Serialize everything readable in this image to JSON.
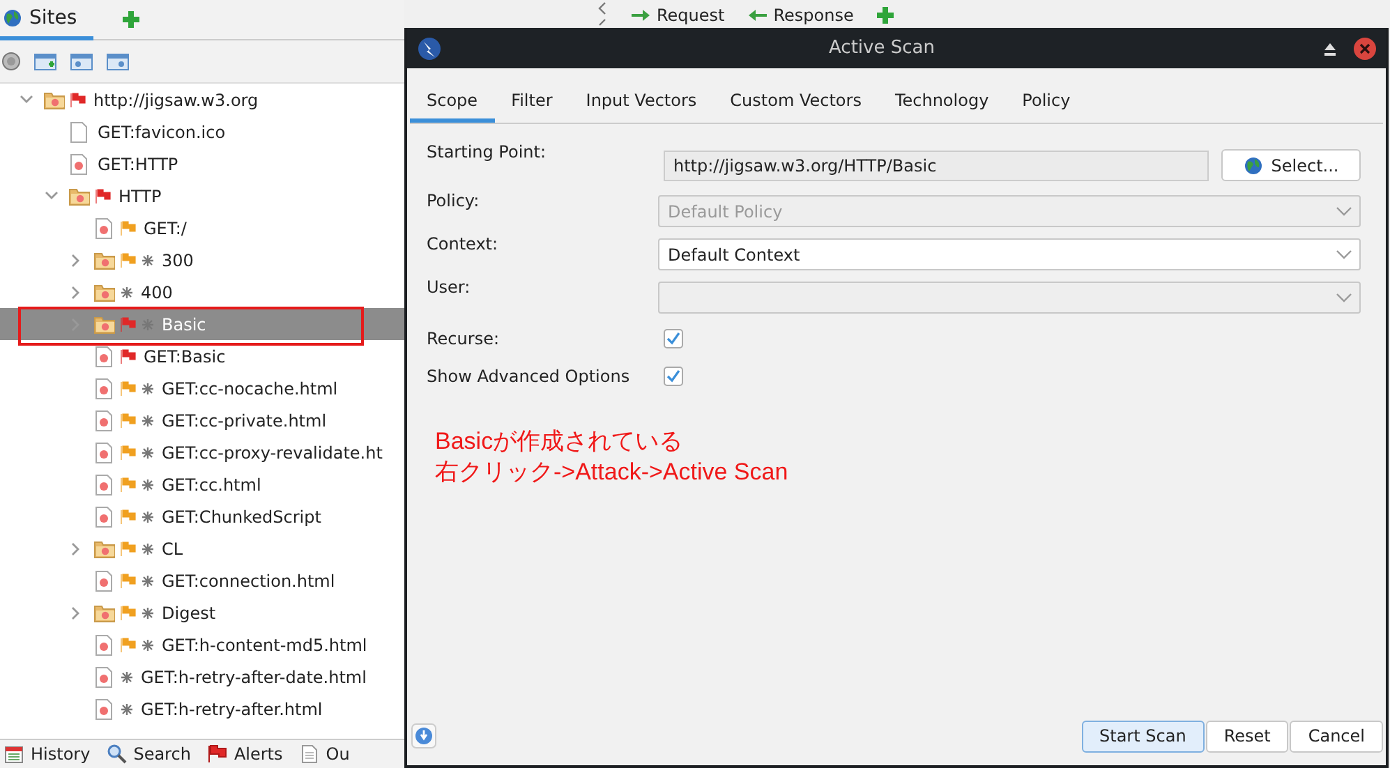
{
  "sites_panel": {
    "tabs": [
      {
        "label": "Sites",
        "selected": true
      }
    ],
    "tree": [
      {
        "label": "http://jigsaw.w3.org",
        "kind": "folder",
        "color": "#e02828",
        "expanded": true,
        "children": [
          {
            "label": "GET:favicon.ico",
            "kind": "blank"
          },
          {
            "label": "GET:HTTP",
            "kind": "page"
          },
          {
            "label": "HTTP",
            "kind": "folder",
            "color": "#e02828",
            "expanded": true,
            "children": [
              {
                "label": "GET:/",
                "kind": "page",
                "color": "#f0a020"
              },
              {
                "label": "300",
                "kind": "folder",
                "color": "#f0a020",
                "spider": true,
                "expanded": false
              },
              {
                "label": "400",
                "kind": "folder",
                "spider": true,
                "expanded": false
              },
              {
                "label": "Basic",
                "kind": "folder",
                "color": "#e02828",
                "spider": true,
                "expanded": false,
                "selected": true,
                "highlight": true
              },
              {
                "label": "GET:Basic",
                "kind": "page",
                "color": "#e02828"
              },
              {
                "label": "GET:cc-nocache.html",
                "kind": "page",
                "color": "#f0a020",
                "spider": true
              },
              {
                "label": "GET:cc-private.html",
                "kind": "page",
                "color": "#f0a020",
                "spider": true
              },
              {
                "label": "GET:cc-proxy-revalidate.ht",
                "kind": "page",
                "color": "#f0a020",
                "spider": true
              },
              {
                "label": "GET:cc.html",
                "kind": "page",
                "color": "#f0a020",
                "spider": true
              },
              {
                "label": "GET:ChunkedScript",
                "kind": "page",
                "color": "#f0a020",
                "spider": true
              },
              {
                "label": "CL",
                "kind": "folder",
                "color": "#f0a020",
                "spider": true,
                "expanded": false
              },
              {
                "label": "GET:connection.html",
                "kind": "page",
                "color": "#f0a020",
                "spider": true
              },
              {
                "label": "Digest",
                "kind": "folder",
                "color": "#f0a020",
                "spider": true,
                "expanded": false
              },
              {
                "label": "GET:h-content-md5.html",
                "kind": "page",
                "color": "#f0a020",
                "spider": true
              },
              {
                "label": "GET:h-retry-after-date.html",
                "kind": "page",
                "spider": true
              },
              {
                "label": "GET:h-retry-after.html",
                "kind": "page",
                "spider": true
              }
            ]
          }
        ]
      }
    ]
  },
  "top_toolbar": {
    "tabs": [
      {
        "label": "Request",
        "kind": "request"
      },
      {
        "label": "Response",
        "kind": "response"
      }
    ]
  },
  "bottom_tabs": [
    {
      "label": "History",
      "kind": "history"
    },
    {
      "label": "Search",
      "kind": "search"
    },
    {
      "label": "Alerts",
      "kind": "alerts"
    },
    {
      "label": "Ou",
      "kind": "output"
    }
  ],
  "dialog": {
    "title": "Active Scan",
    "tabs": [
      {
        "label": "Scope",
        "selected": true
      },
      {
        "label": "Filter",
        "selected": false
      },
      {
        "label": "Input Vectors",
        "selected": false
      },
      {
        "label": "Custom Vectors",
        "selected": false
      },
      {
        "label": "Technology",
        "selected": false
      },
      {
        "label": "Policy",
        "selected": false
      }
    ],
    "fields": [
      {
        "label": "Starting Point:",
        "kind": "text",
        "value": "http://jigsaw.w3.org/HTTP/Basic",
        "button": "Select..."
      },
      {
        "label": "Policy:",
        "kind": "combo",
        "value": "Default Policy",
        "disabled": true
      },
      {
        "label": "Context:",
        "kind": "combo",
        "value": "Default Context",
        "disabled": false
      },
      {
        "label": "User:",
        "kind": "combo",
        "disabled": true
      },
      {
        "label": "Recurse:",
        "kind": "check",
        "checked": true
      },
      {
        "label": "Show Advanced Options",
        "kind": "check",
        "checked": true
      }
    ],
    "annotation": [
      "Basicが作成されている",
      "右クリック->Attack->Active Scan"
    ],
    "buttons": [
      {
        "label": "Start Scan",
        "default": true
      },
      {
        "label": "Reset",
        "default": false
      },
      {
        "label": "Cancel",
        "default": false
      }
    ]
  }
}
